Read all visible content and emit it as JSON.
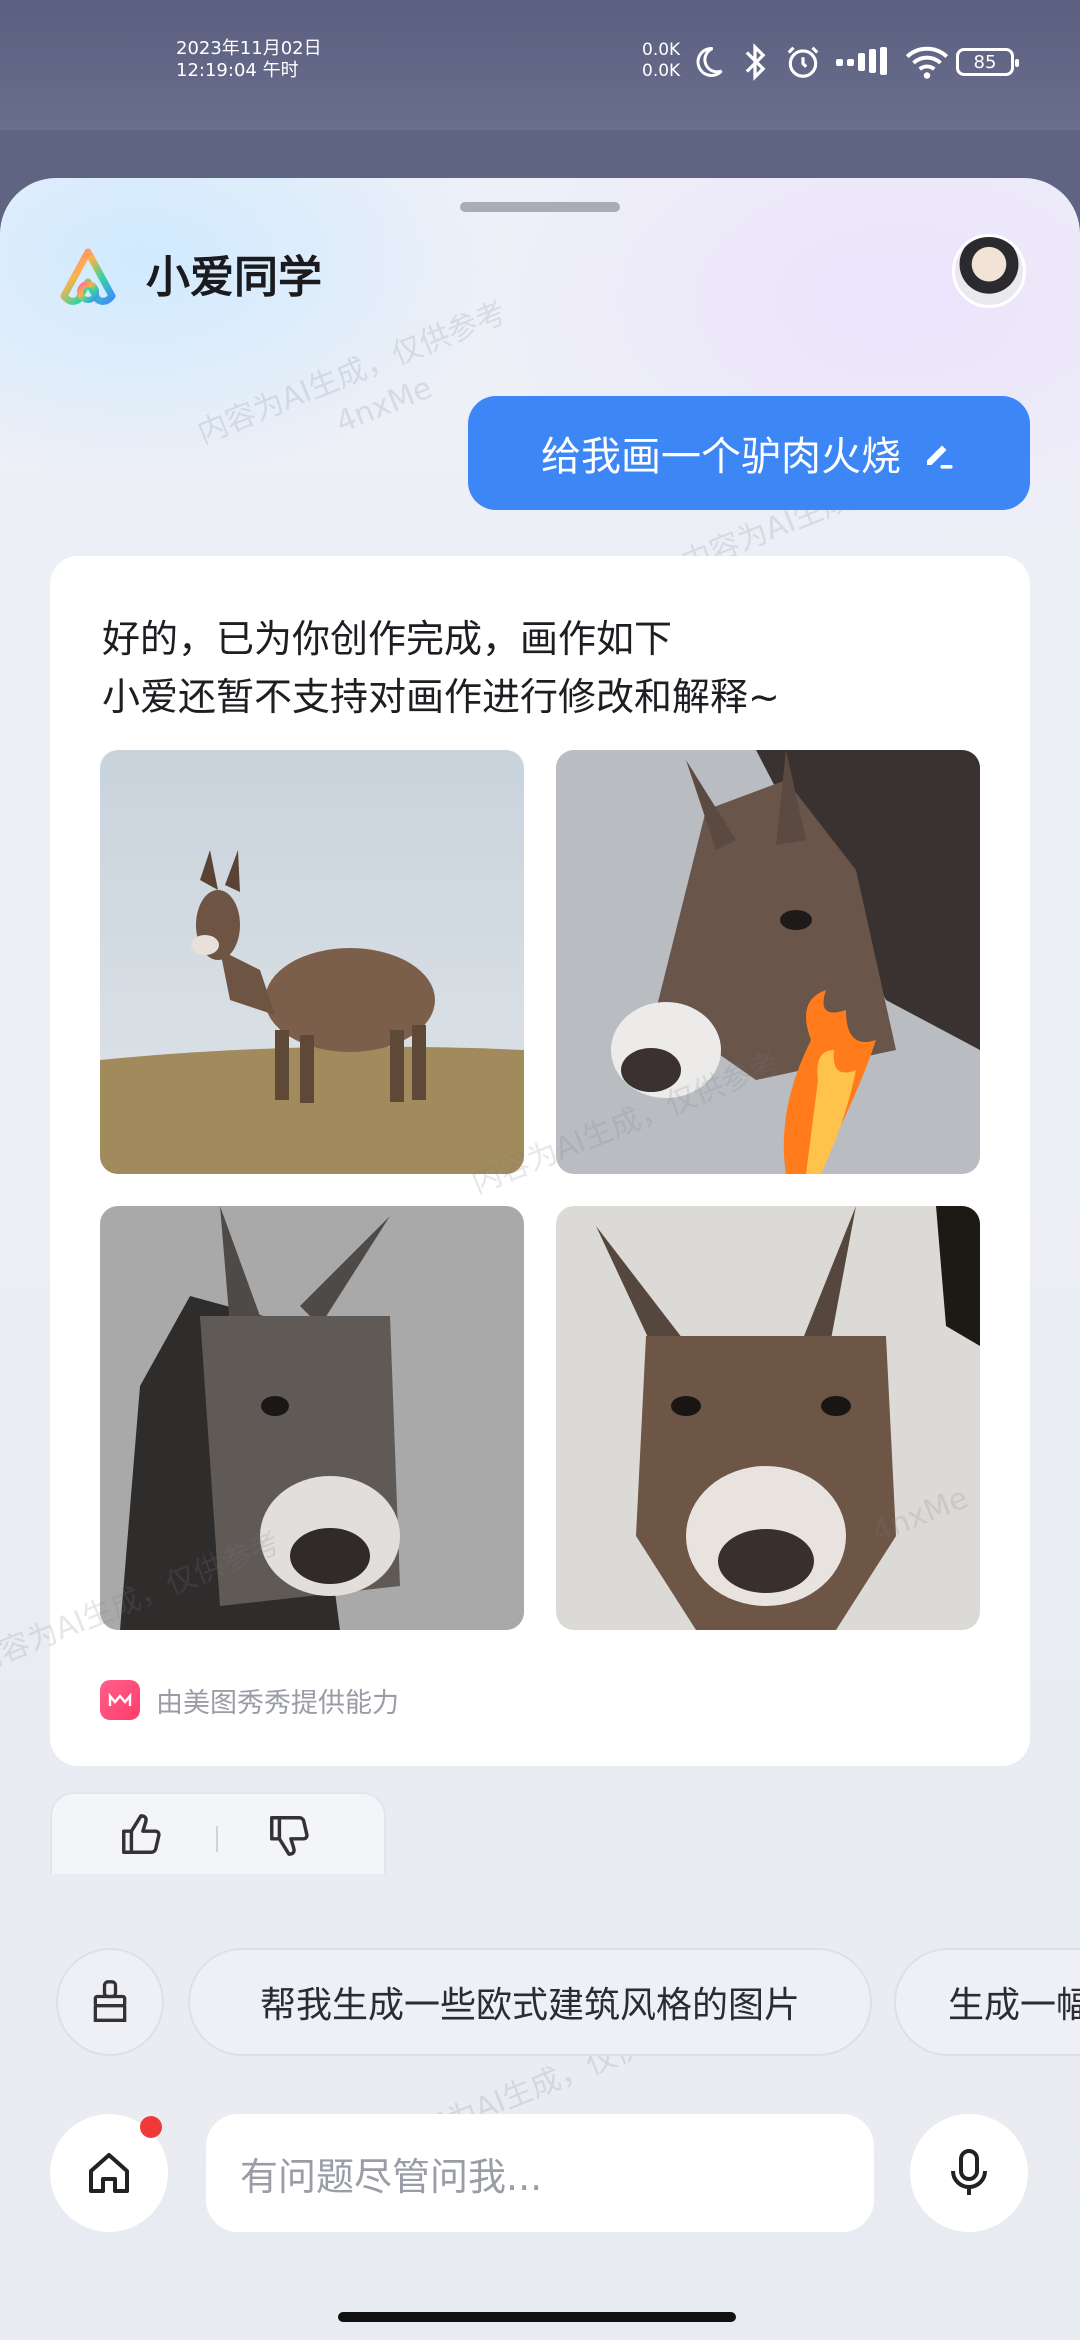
{
  "status_bar": {
    "date": "2023年11月02日",
    "time": "12:19:04 午时",
    "net_up": "0.0K",
    "net_down": "0.0K",
    "battery": "85",
    "icons": [
      "moon-icon",
      "bluetooth-icon",
      "alarm-icon",
      "signal-icon",
      "wifi-icon"
    ]
  },
  "header": {
    "title": "小爱同学"
  },
  "watermark": {
    "text_1": "内容为AI生成，仅供参考",
    "text_2": "4nxMe"
  },
  "user_message": {
    "text": "给我画一个驴肉火烧"
  },
  "reply": {
    "line_1": "好的，已为你创作完成，画作如下",
    "line_2": "小爱还暂不支持对画作进行修改和解释~",
    "images": [
      "donkey-standing-image",
      "donkey-fire-image",
      "donkey-gray-image",
      "donkey-front-image"
    ],
    "provider": "由美图秀秀提供能力"
  },
  "suggestions": {
    "items": [
      "帮我生成一些欧式建筑风格的图片",
      "生成一幅"
    ]
  },
  "input": {
    "placeholder": "有问题尽管问我..."
  },
  "colors": {
    "accent": "#3d86f5",
    "badge": "#f03a3a"
  }
}
